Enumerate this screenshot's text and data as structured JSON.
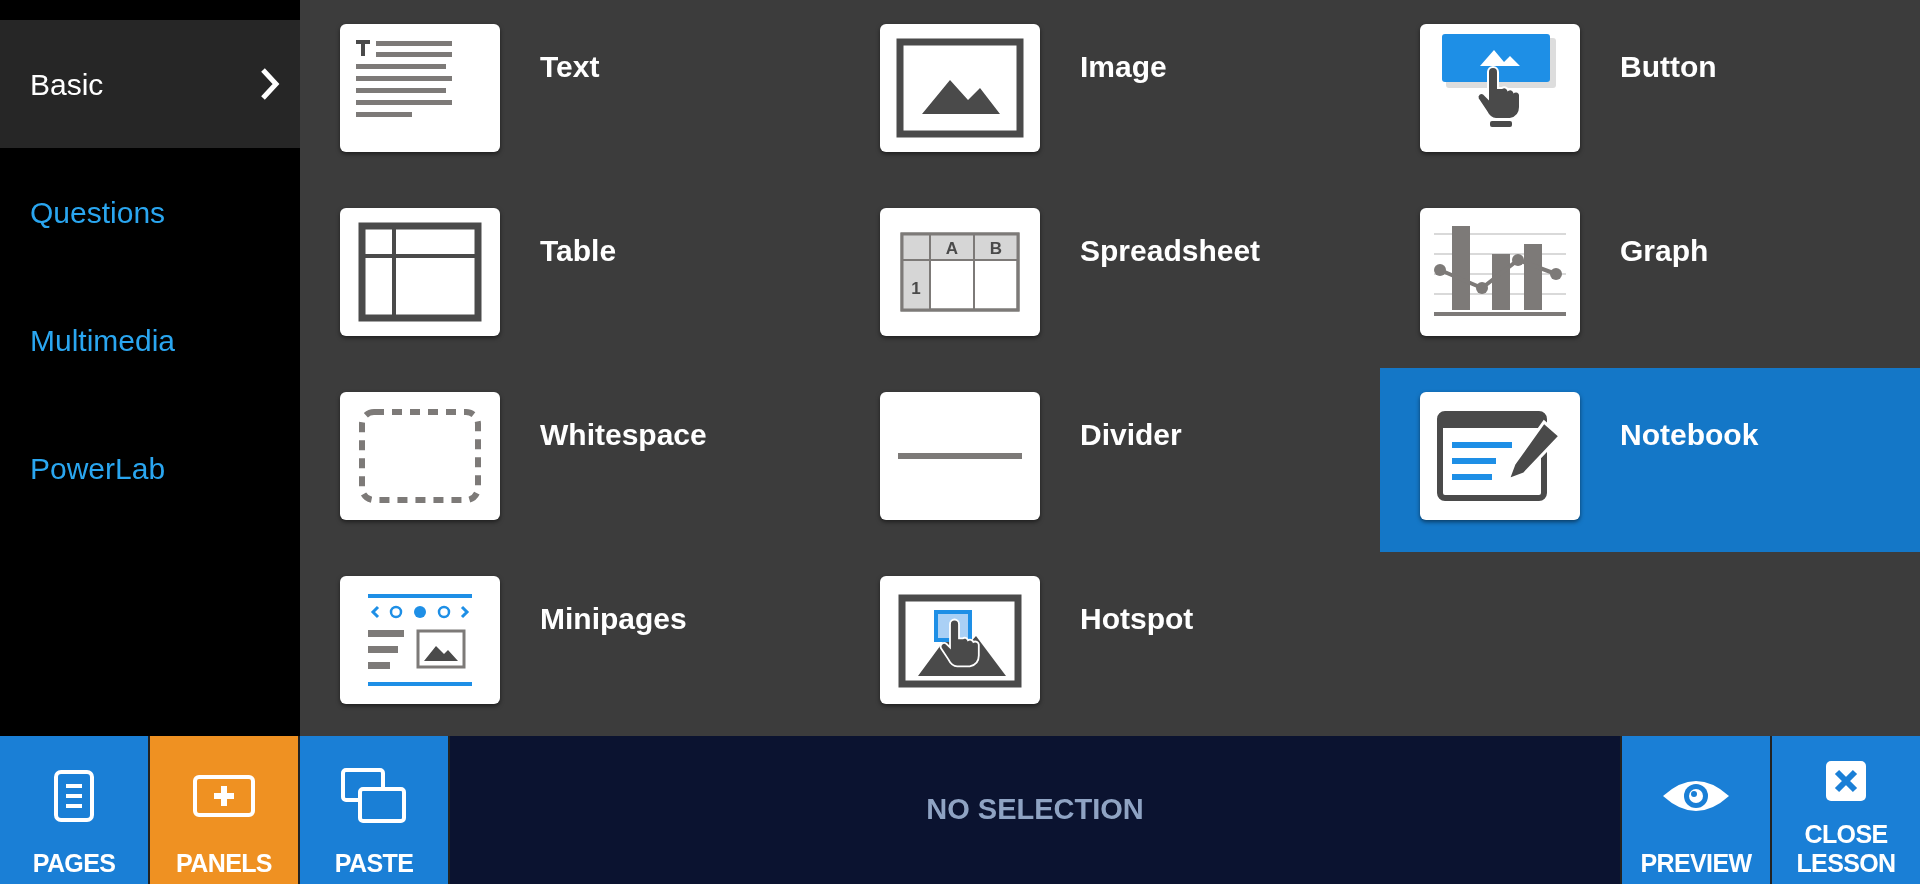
{
  "sidebar": {
    "items": [
      {
        "label": "Basic",
        "selected": true
      },
      {
        "label": "Questions",
        "selected": false
      },
      {
        "label": "Multimedia",
        "selected": false
      },
      {
        "label": "PowerLab",
        "selected": false
      }
    ]
  },
  "panels": [
    {
      "kind": "text",
      "label": "Text",
      "selected": false
    },
    {
      "kind": "image",
      "label": "Image",
      "selected": false
    },
    {
      "kind": "button",
      "label": "Button",
      "selected": false
    },
    {
      "kind": "table",
      "label": "Table",
      "selected": false
    },
    {
      "kind": "spreadsheet",
      "label": "Spreadsheet",
      "selected": false,
      "icon_labels": [
        "A",
        "B",
        "1"
      ]
    },
    {
      "kind": "graph",
      "label": "Graph",
      "selected": false
    },
    {
      "kind": "whitespace",
      "label": "Whitespace",
      "selected": false
    },
    {
      "kind": "divider",
      "label": "Divider",
      "selected": false
    },
    {
      "kind": "notebook",
      "label": "Notebook",
      "selected": true
    },
    {
      "kind": "minipages",
      "label": "Minipages",
      "selected": false
    },
    {
      "kind": "hotspot",
      "label": "Hotspot",
      "selected": false
    }
  ],
  "toolbar": {
    "left": [
      {
        "kind": "pages",
        "label": "PAGES",
        "selected": false
      },
      {
        "kind": "panels",
        "label": "PANELS",
        "selected": true
      },
      {
        "kind": "paste",
        "label": "PASTE",
        "selected": false
      }
    ],
    "status": "NO SELECTION",
    "right": [
      {
        "kind": "preview",
        "label": "PREVIEW"
      },
      {
        "kind": "close",
        "label": "CLOSE LESSON"
      }
    ]
  }
}
